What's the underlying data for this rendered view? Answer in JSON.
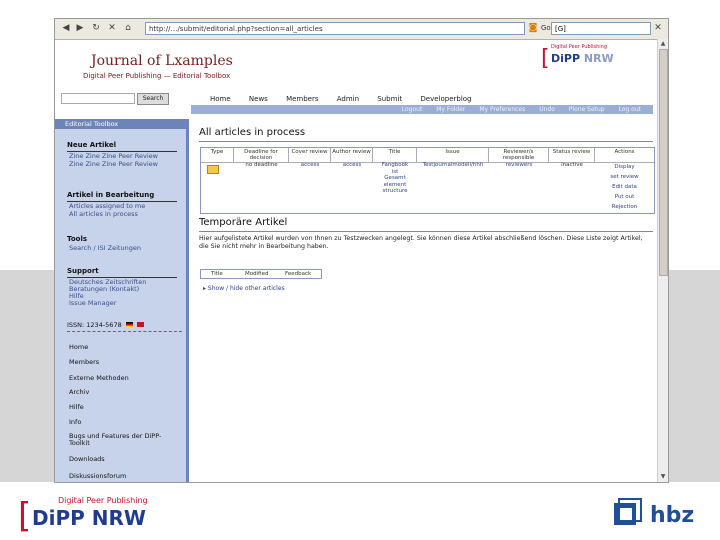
{
  "browser": {
    "url": "http://…/submit/editorial.php?section=all_articles",
    "go_label": "Go",
    "search_value": "[G]"
  },
  "page": {
    "journal_title": "Journal of Lxamples",
    "journal_subtitle": "Digital Peer Publishing — Editorial Toolbox",
    "header_logo": {
      "tag": "Digital Peer Publishing",
      "name_a": "DiPP",
      "name_b": " NRW"
    },
    "search_button": "Search",
    "top_nav": [
      "Home",
      "News",
      "Members",
      "Admin",
      "Submit",
      "Developerblog"
    ],
    "sub_nav": [
      "Logout",
      "My Folder",
      "My Preferences",
      "Undo",
      "Plone Setup",
      "Log out"
    ]
  },
  "sidebar": {
    "title": "Editorial Toolbox",
    "sections": [
      {
        "heading": "Neue Artikel",
        "links": [
          "Zine Zine Zine Peer Review",
          "Zine Zine Zine Peer Review"
        ]
      },
      {
        "heading": "Artikel in Bearbeitung",
        "links": [
          "Articles assigned to me",
          "All articles in process"
        ]
      },
      {
        "heading": "Tools",
        "links": [
          "Search / ISI Zeitungen"
        ]
      },
      {
        "heading": "Support",
        "links": [
          "Deutsches Zeitschriften",
          "Beratungen (Kontakt)",
          "Hilfe",
          "Issue Manager"
        ]
      }
    ],
    "issn": "ISSN: 1234-5678",
    "menu": [
      "Home",
      "Members",
      "Externe Methoden",
      "Archiv",
      "Hilfe",
      "Info",
      "Bugs und Features der DiPP-Toolkit",
      "Downloads",
      "Diskussionsforum"
    ]
  },
  "main": {
    "heading": "All articles in process",
    "table": {
      "headers": [
        "Type",
        "Deadline for decision",
        "Cover review",
        "Author review",
        "Title",
        "Issue",
        "Reviewer/s responsible",
        "Status review",
        "Actions"
      ],
      "row": {
        "deadline": "no deadline",
        "cover": "access",
        "author": "access",
        "title": [
          "Fangbook",
          "ist",
          "Gesamt",
          "element",
          "structure"
        ],
        "issue": "Testjournalmodell/hhh",
        "reviewer": "reviewers",
        "status": "inactive",
        "actions": [
          "Display",
          "set review",
          "Edit data",
          "Put out",
          "Rejection"
        ]
      }
    },
    "heading2": "Temporäre Artikel",
    "paragraph": "Hier aufgelistete Artikel wurden von Ihnen zu Testzwecken angelegt. Sie können diese Artikel abschließend löschen. Diese Liste zeigt Artikel, die Sie nicht mehr in Bearbeitung haben.",
    "table2_headers": [
      "Title",
      "Modified",
      "Feedback"
    ],
    "show_link": "Show / hide other articles"
  },
  "footer": {
    "dipp_tag": "Digital Peer Publishing",
    "dipp_a": "DiPP",
    "dipp_b": " NRW",
    "hbz": "hbz"
  },
  "colors": {
    "dipp_red": "#c8102e",
    "dipp_blue": "#1f3c8e",
    "sidebar_bg": "#c7d3ea",
    "sidebar_bar": "#6d84b8",
    "hbz_blue": "#1f4e9a"
  }
}
